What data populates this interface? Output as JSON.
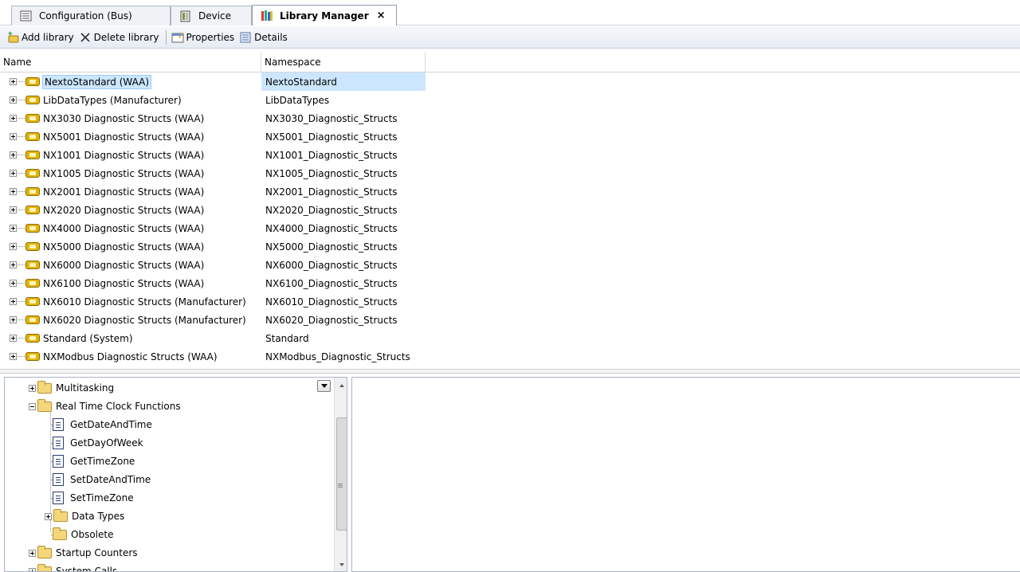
{
  "tabs": [
    {
      "label": "Configuration (Bus)",
      "icon": "config-bus-icon",
      "active": false
    },
    {
      "label": "Device",
      "icon": "device-icon",
      "active": false
    },
    {
      "label": "Library Manager",
      "icon": "library-manager-icon",
      "active": true
    }
  ],
  "tab_close": "×",
  "toolbar": {
    "add_library": "Add library",
    "delete_library": "Delete library",
    "properties": "Properties",
    "details": "Details"
  },
  "grid": {
    "headers": {
      "name": "Name",
      "namespace": "Namespace"
    },
    "rows": [
      {
        "name": "NextoStandard (WAA)",
        "namespace": "NextoStandard",
        "selected": true
      },
      {
        "name": "LibDataTypes (Manufacturer)",
        "namespace": "LibDataTypes"
      },
      {
        "name": "NX3030 Diagnostic Structs (WAA)",
        "namespace": "NX3030_Diagnostic_Structs"
      },
      {
        "name": "NX5001 Diagnostic Structs (WAA)",
        "namespace": "NX5001_Diagnostic_Structs"
      },
      {
        "name": "NX1001 Diagnostic Structs (WAA)",
        "namespace": "NX1001_Diagnostic_Structs"
      },
      {
        "name": "NX1005 Diagnostic Structs (WAA)",
        "namespace": "NX1005_Diagnostic_Structs"
      },
      {
        "name": "NX2001 Diagnostic Structs (WAA)",
        "namespace": "NX2001_Diagnostic_Structs"
      },
      {
        "name": "NX2020 Diagnostic Structs (WAA)",
        "namespace": "NX2020_Diagnostic_Structs"
      },
      {
        "name": "NX4000 Diagnostic Structs (WAA)",
        "namespace": "NX4000_Diagnostic_Structs"
      },
      {
        "name": "NX5000 Diagnostic Structs (WAA)",
        "namespace": "NX5000_Diagnostic_Structs"
      },
      {
        "name": "NX6000 Diagnostic Structs (WAA)",
        "namespace": "NX6000_Diagnostic_Structs"
      },
      {
        "name": "NX6100 Diagnostic Structs (WAA)",
        "namespace": "NX6100_Diagnostic_Structs"
      },
      {
        "name": "NX6010 Diagnostic Structs (Manufacturer)",
        "namespace": "NX6010_Diagnostic_Structs"
      },
      {
        "name": "NX6020 Diagnostic Structs (Manufacturer)",
        "namespace": "NX6020_Diagnostic_Structs"
      },
      {
        "name": "Standard (System)",
        "namespace": "Standard"
      },
      {
        "name": "NXModbus Diagnostic Structs (WAA)",
        "namespace": "NXModbus_Diagnostic_Structs"
      }
    ]
  },
  "tree": {
    "items": [
      {
        "label": "Multitasking",
        "type": "folder",
        "expander": "plus"
      },
      {
        "label": "Real Time Clock Functions",
        "type": "folder",
        "expander": "minus"
      },
      {
        "label": "GetDateAndTime",
        "type": "function"
      },
      {
        "label": "GetDayOfWeek",
        "type": "function"
      },
      {
        "label": "GetTimeZone",
        "type": "function"
      },
      {
        "label": "SetDateAndTime",
        "type": "function"
      },
      {
        "label": "SetTimeZone",
        "type": "function"
      },
      {
        "label": "Data Types",
        "type": "folder",
        "expander": "plus"
      },
      {
        "label": "Obsolete",
        "type": "folder"
      },
      {
        "label": "Startup Counters",
        "type": "folder",
        "expander": "plus"
      },
      {
        "label": "System Calls",
        "type": "folder",
        "expander": "plus"
      }
    ]
  },
  "colors": {
    "selection": "#cce6ff",
    "toolbar_bg": "#e7ecf3",
    "border": "#aab4c3"
  }
}
